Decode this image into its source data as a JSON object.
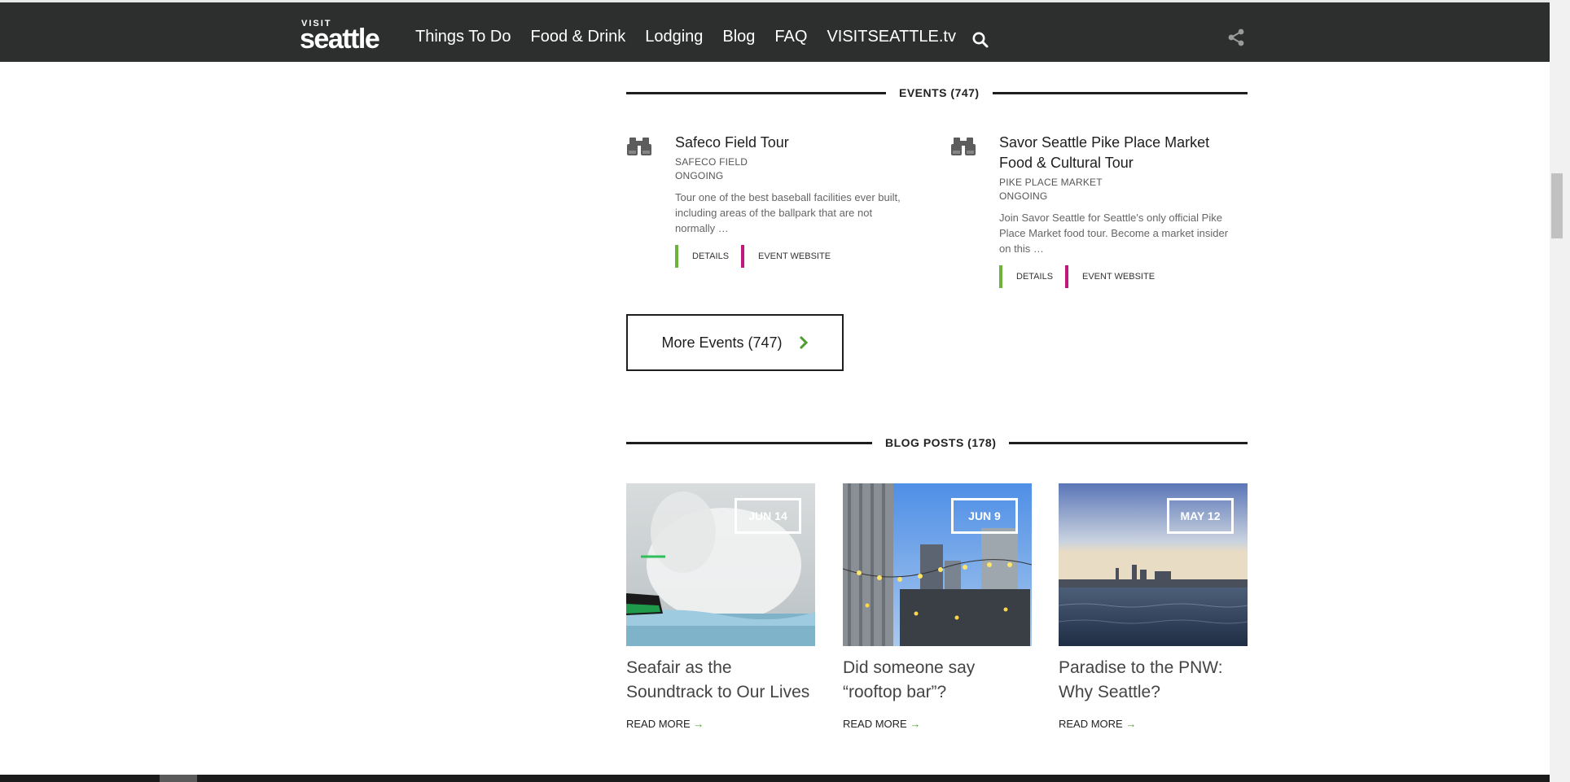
{
  "nav": {
    "logo_small": "VISIT",
    "logo_big": "seattle",
    "links": [
      "Things To Do",
      "Food & Drink",
      "Lodging",
      "Blog",
      "FAQ",
      "VISITSEATTLE.tv"
    ],
    "search_icon": "search-icon",
    "share_icon": "share-icon"
  },
  "events_section": {
    "title": "EVENTS (747)",
    "events": [
      {
        "title_lines": [
          "Safeco Field Tour"
        ],
        "venue": "SAFECO FIELD",
        "date": "ONGOING",
        "desc_lines": [
          "Tour one of the best baseball facilities ever built,",
          "including areas of the ballpark that are not",
          "normally …"
        ],
        "details_label": "DETAILS",
        "website_label": "EVENT WEBSITE"
      },
      {
        "title_lines": [
          "Savor Seattle Pike Place Market",
          "Food & Cultural Tour"
        ],
        "venue": "PIKE PLACE MARKET",
        "date": "ONGOING",
        "desc_lines": [
          "Join Savor Seattle for Seattle's only official Pike",
          "Place Market food tour. Become a market insider",
          "on this …"
        ],
        "details_label": "DETAILS",
        "website_label": "EVENT WEBSITE"
      }
    ],
    "more_label": "More Events (747)",
    "icon": "binoculars-icon",
    "details_color": "#6cb33e",
    "website_color": "#c1177c"
  },
  "blog_section": {
    "title": "BLOG POSTS (178)",
    "posts": [
      {
        "date": "JUN 14",
        "title_lines": [
          "Seafair as the",
          "Soundtrack to Our Lives"
        ],
        "read_more": "READ MORE"
      },
      {
        "date": "JUN 9",
        "title_lines": [
          "Did someone say",
          "“rooftop bar”?"
        ],
        "read_more": "READ MORE"
      },
      {
        "date": "MAY 12",
        "title_lines": [
          "Paradise to the PNW:",
          "Why Seattle?"
        ],
        "read_more": "READ MORE"
      }
    ]
  }
}
